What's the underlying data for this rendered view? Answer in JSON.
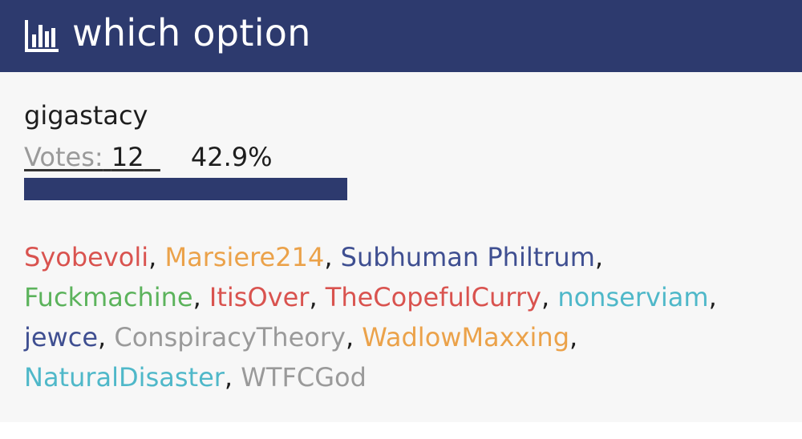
{
  "header": {
    "icon": "bar-chart-icon",
    "title": "which option",
    "color": "#2d3a6e"
  },
  "option": {
    "name": "gigastacy",
    "votes_label": "Votes:",
    "votes_count": "12",
    "percent": "42.9%",
    "fraction": 0.429,
    "bar_color": "#2d3a6e"
  },
  "voters": [
    {
      "name": "Syobevoli",
      "color": "#d9534f"
    },
    {
      "name": "Marsiere214",
      "color": "#eba24a"
    },
    {
      "name": "Subhuman Philtrum",
      "color": "#3f4f91"
    },
    {
      "name": "Fuckmachine",
      "color": "#5cb35c"
    },
    {
      "name": "ItisOver",
      "color": "#d9534f"
    },
    {
      "name": "TheCopefulCurry",
      "color": "#d9534f"
    },
    {
      "name": "nonserviam",
      "color": "#4fb8c9"
    },
    {
      "name": "jewce",
      "color": "#3f4f91"
    },
    {
      "name": "ConspiracyTheory",
      "color": "#9a9a9a"
    },
    {
      "name": "WadlowMaxxing",
      "color": "#eba24a"
    },
    {
      "name": "NaturalDisaster",
      "color": "#4fb8c9"
    },
    {
      "name": "WTFCGod",
      "color": "#9a9a9a"
    }
  ],
  "separator": ", "
}
